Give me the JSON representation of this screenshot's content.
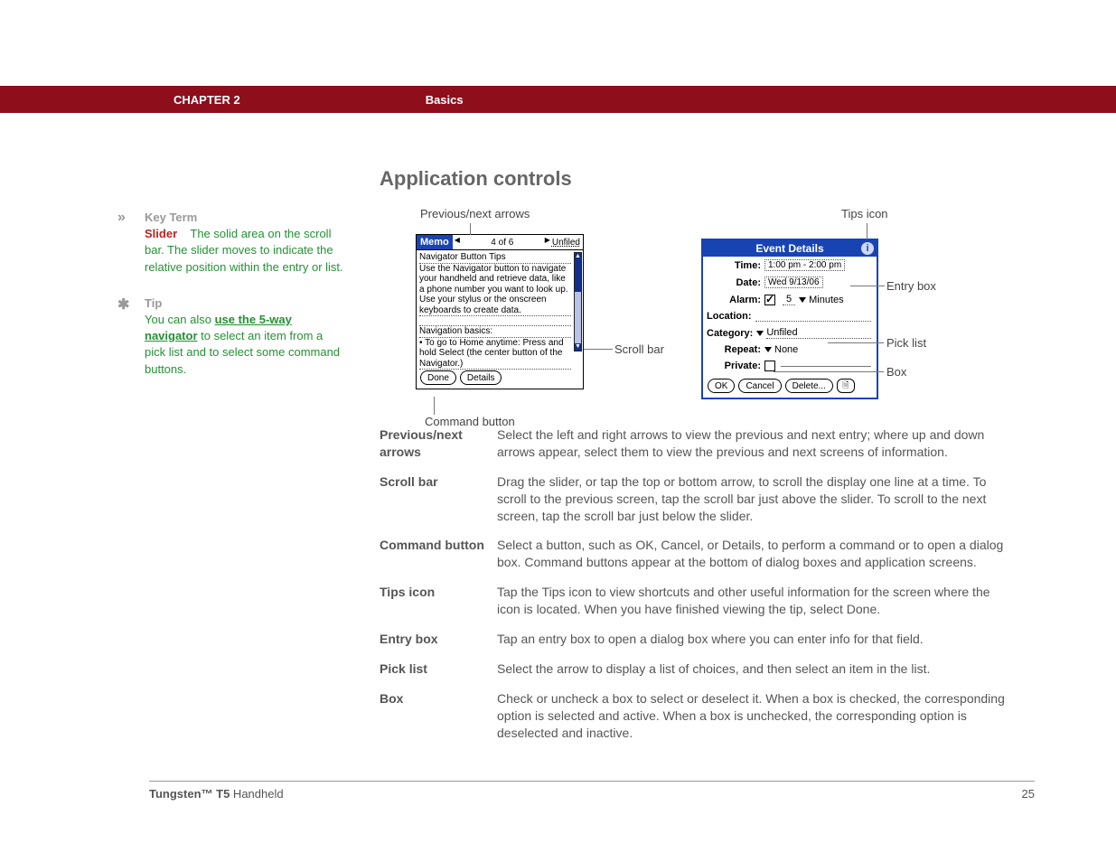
{
  "header": {
    "chapter": "CHAPTER 2",
    "section": "Basics"
  },
  "sidebar": {
    "keyterm": {
      "label": "Key Term",
      "term": "Slider",
      "def": "The solid area on the scroll bar. The slider moves to indicate the relative position within the entry or list."
    },
    "tip": {
      "label": "Tip",
      "pre": "You can also ",
      "link": "use the 5-way navigator",
      "post": " to select an item from a pick list and to select some command buttons."
    }
  },
  "title": "Application controls",
  "annot": {
    "prevnext": "Previous/next arrows",
    "scrollbar": "Scroll bar",
    "cmdbtn": "Command button",
    "tips": "Tips icon",
    "entry": "Entry box",
    "pick": "Pick list",
    "box": "Box"
  },
  "memo": {
    "app": "Memo",
    "counter": "4 of 6",
    "category": "Unfiled",
    "line1": "Navigator Button Tips",
    "line2": "Use the Navigator button to navigate your handheld and retrieve data, like a phone number you want to look up. Use your stylus or the onscreen keyboards to create data.",
    "line3": "Navigation basics:",
    "line4": "• To go to Home anytime: Press and hold Select (the center button of the Navigator.)",
    "btn_done": "Done",
    "btn_details": "Details"
  },
  "event": {
    "title": "Event Details",
    "time_label": "Time:",
    "time_val": "1:00 pm - 2:00 pm",
    "date_label": "Date:",
    "date_val": "Wed 9/13/06",
    "alarm_label": "Alarm:",
    "alarm_num": "5",
    "alarm_unit": "Minutes",
    "loc_label": "Location:",
    "cat_label": "Category:",
    "cat_val": "Unfiled",
    "rep_label": "Repeat:",
    "rep_val": "None",
    "priv_label": "Private:",
    "btn_ok": "OK",
    "btn_cancel": "Cancel",
    "btn_delete": "Delete..."
  },
  "defs": [
    {
      "term": "Previous/next arrows",
      "desc": "Select the left and right arrows to view the previous and next entry; where up and down arrows appear, select them to view the previous and next screens of information."
    },
    {
      "term": "Scroll bar",
      "desc": "Drag the slider, or tap the top or bottom arrow, to scroll the display one line at a time. To scroll to the previous screen, tap the scroll bar just above the slider. To scroll to the next screen, tap the scroll bar just below the slider."
    },
    {
      "term": "Command button",
      "desc": "Select a button, such as OK, Cancel, or Details, to perform a command or to open a dialog box. Command buttons appear at the bottom of dialog boxes and application screens."
    },
    {
      "term": "Tips icon",
      "desc": "Tap the Tips icon to view shortcuts and other useful information for the screen where the icon is located. When you have finished viewing the tip, select Done."
    },
    {
      "term": "Entry box",
      "desc": "Tap an entry box to open a dialog box where you can enter info for that field."
    },
    {
      "term": "Pick list",
      "desc": "Select the arrow to display a list of choices, and then select an item in the list."
    },
    {
      "term": "Box",
      "desc": "Check or uncheck a box to select or deselect it. When a box is checked, the corresponding option is selected and active. When a box is unchecked, the corresponding option is deselected and inactive."
    }
  ],
  "footer": {
    "product_bold": "Tungsten™ T5",
    "product_rest": " Handheld",
    "page": "25"
  }
}
